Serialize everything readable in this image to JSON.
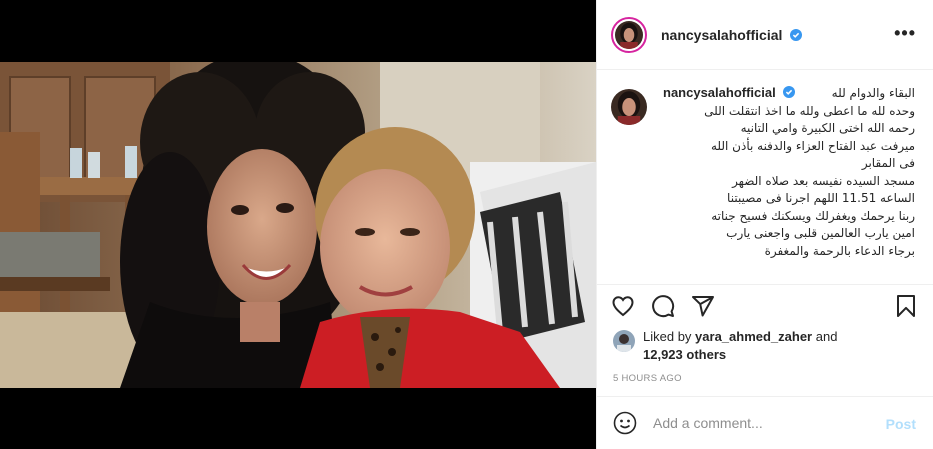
{
  "post": {
    "username": "nancysalahofficial",
    "verified": true,
    "caption_lines": [
      "البقاء والدوام لله",
      "وحده لله ما اعطى ولله ما اخذ انتقلت اللى",
      "رحمه الله اختى الكبيرة وامي التانيه",
      "ميرفت عبد الفتاح العزاء والدفنه بأذن الله",
      "فى المقابر",
      "مسجد السيده نفيسه بعد صلاه الضهر",
      "الساعه 11.51 اللهم اجرنا فى مصيبتنا",
      "ربنا يرحمك ويغفرلك ويسكنك فسيح جناته",
      "امين يارب العالمين قلبى واجعنى يارب",
      "برجاء الدعاء بالرحمة والمغفرة"
    ],
    "likes": {
      "prefix": "Liked by",
      "user": "yara_ahmed_zaher",
      "and": "and",
      "count": "12,923 others"
    },
    "timestamp": "5 HOURS AGO"
  },
  "comment": {
    "placeholder": "Add a comment...",
    "post_label": "Post"
  },
  "icons": {
    "more": "more-options-icon",
    "like": "heart-icon",
    "comment": "comment-bubble-icon",
    "share": "paper-plane-icon",
    "save": "bookmark-icon",
    "emoji": "emoji-smiley-icon",
    "verified": "verified-badge-icon"
  },
  "colors": {
    "verified": "#3897f0",
    "post_disabled": "#b2dffc",
    "meta": "#8e8e8e",
    "story_ring": "#d6249f"
  }
}
